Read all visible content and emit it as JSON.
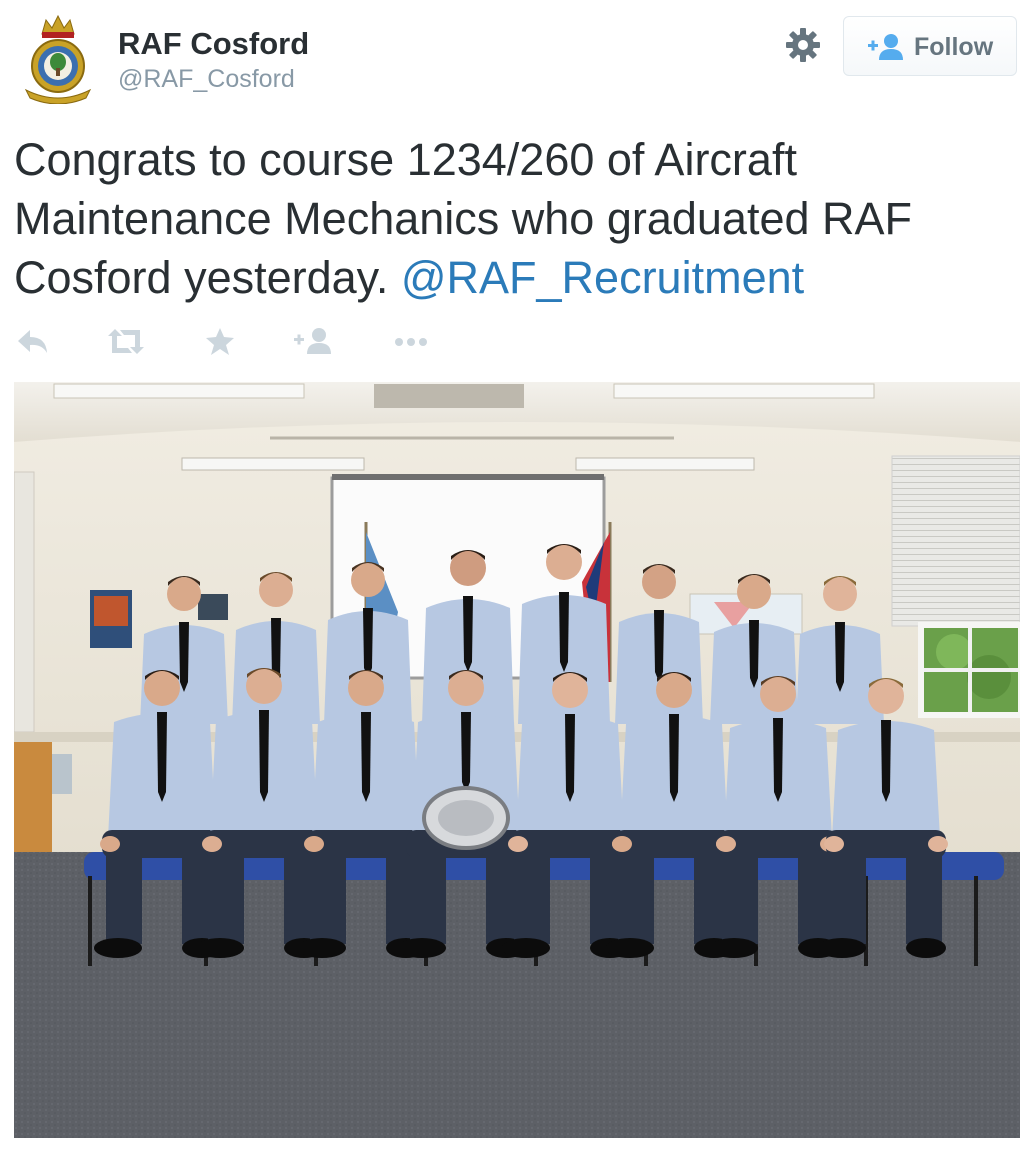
{
  "tweet": {
    "author": {
      "name": "RAF Cosford",
      "handle": "@RAF_Cosford",
      "avatar_icon": "raf-station-crest-icon"
    },
    "follow_button": {
      "label": "Follow",
      "icon": "add-user-icon"
    },
    "settings_icon": "gear-icon",
    "text": {
      "main": "Congrats to course 1234/260 of Aircraft Maintenance Mechanics who graduated RAF Cosford yesterday. ",
      "mention": "@RAF_Recruitment"
    },
    "actions": [
      {
        "name": "reply-icon"
      },
      {
        "name": "retweet-icon"
      },
      {
        "name": "favorite-icon"
      },
      {
        "name": "follow-small-icon"
      },
      {
        "name": "more-icon"
      }
    ],
    "photo": {
      "description_icon": "group-photo-graduates"
    }
  },
  "colors": {
    "text": "#292f33",
    "muted": "#8899a6",
    "link": "#2b7bb9",
    "action_icon": "#ccd6dd",
    "follow_icon": "#55acee",
    "uniform_shirt": "#b7c8e2",
    "uniform_trousers": "#2b3446",
    "chair_blue": "#2f4fa6",
    "carpet": "#5f6268",
    "wall": "#e8e3d6"
  }
}
